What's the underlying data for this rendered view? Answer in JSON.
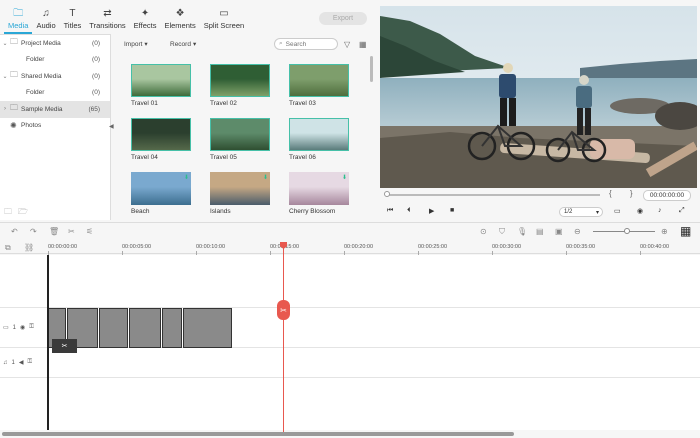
{
  "tabs": [
    {
      "label": "Media",
      "icon": "folder-icon",
      "glyph": "🗀",
      "active": true
    },
    {
      "label": "Audio",
      "icon": "music-note-icon",
      "glyph": "♫"
    },
    {
      "label": "Titles",
      "icon": "text-icon",
      "glyph": "T"
    },
    {
      "label": "Transitions",
      "icon": "transition-icon",
      "glyph": "⇄"
    },
    {
      "label": "Effects",
      "icon": "effects-icon",
      "glyph": "✦"
    },
    {
      "label": "Elements",
      "icon": "elements-icon",
      "glyph": "❖"
    },
    {
      "label": "Split Screen",
      "icon": "split-screen-icon",
      "glyph": "▭"
    }
  ],
  "export_label": "Export",
  "library": {
    "items": [
      {
        "label": "Project Media",
        "count": "(0)",
        "level": 0
      },
      {
        "label": "Folder",
        "count": "(0)",
        "level": 1
      },
      {
        "label": "Shared Media",
        "count": "(0)",
        "level": 0
      },
      {
        "label": "Folder",
        "count": "(0)",
        "level": 1
      },
      {
        "label": "Sample Media",
        "count": "(65)",
        "level": 0,
        "selected": true
      },
      {
        "label": "Photos",
        "count": "",
        "level": 0
      }
    ]
  },
  "media_bar": {
    "import_label": "Import",
    "record_label": "Record",
    "search_placeholder": "Search"
  },
  "thumbnails": [
    {
      "label": "Travel 01",
      "col": 0,
      "row": 0,
      "sky": "#a9c6a0",
      "ground": "#3e6b3a"
    },
    {
      "label": "Travel 02",
      "col": 1,
      "row": 0,
      "sky": "#2f5e34",
      "ground": "#7fa169"
    },
    {
      "label": "Travel 03",
      "col": 2,
      "row": 0,
      "sky": "#7e9e6c",
      "ground": "#4f6e3d"
    },
    {
      "label": "Travel 04",
      "col": 0,
      "row": 1,
      "sky": "#2b3f2e",
      "ground": "#55694a"
    },
    {
      "label": "Travel 05",
      "col": 1,
      "row": 1,
      "sky": "#5d8b6a",
      "ground": "#2f4f31"
    },
    {
      "label": "Travel 06",
      "col": 2,
      "row": 1,
      "sky": "#cfe3e6",
      "ground": "#5a7c7b"
    },
    {
      "label": "Beach",
      "col": 0,
      "row": 2,
      "sky": "#7aa9cf",
      "ground": "#3c6e8f"
    },
    {
      "label": "Islands",
      "col": 1,
      "row": 2,
      "sky": "#c5a884",
      "ground": "#4a5c6b"
    },
    {
      "label": "Cherry Blossom",
      "col": 2,
      "row": 2,
      "sky": "#e6d9e3",
      "ground": "#a6879c"
    }
  ],
  "preview": {
    "timecode": "00:00:00:00",
    "quality": "1/2"
  },
  "ruler_ticks": [
    "00:00:00:00",
    "00:00:05:00",
    "00:00:10:00",
    "00:00:15:00",
    "00:00:20:00",
    "00:00:25:00",
    "00:00:30:00",
    "00:00:35:00",
    "00:00:40:00"
  ],
  "tracks": [
    {
      "name": "video-track",
      "label": "1"
    },
    {
      "name": "audio-track",
      "label": "1"
    }
  ],
  "colors": {
    "accent": "#2aa7d6",
    "playhead": "#e8584f",
    "thumb_border": "#46c0a8"
  }
}
